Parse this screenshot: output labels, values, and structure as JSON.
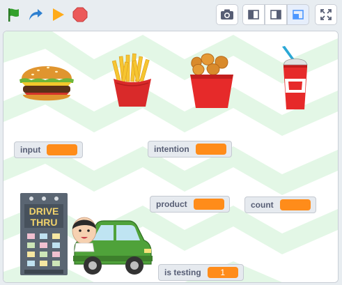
{
  "toolbar": {
    "icons": [
      "green-flag-icon",
      "turbo-arrow-icon",
      "play-icon",
      "stop-icon",
      "camera-icon",
      "small-stage-icon",
      "large-stage-icon",
      "custom-stage-icon",
      "fullscreen-icon"
    ],
    "colors": {
      "flag": "#33a02c",
      "turbo": "#2f80d0",
      "play": "#ffab19",
      "stop": "#ec5959",
      "active_view": "#4c97ff"
    }
  },
  "stage": {
    "background_colors": {
      "stripe": "#e3f7e6",
      "base": "#ffffff"
    },
    "sprites": [
      "burger",
      "fries",
      "chicken-nuggets",
      "drink",
      "drive-thru-sign",
      "car-with-driver"
    ],
    "drive_thru_sign": {
      "line1": "DRIVE",
      "line2": "THRU"
    }
  },
  "monitors": {
    "input": {
      "label": "input",
      "value": ""
    },
    "intention": {
      "label": "intention",
      "value": ""
    },
    "product": {
      "label": "product",
      "value": ""
    },
    "count": {
      "label": "count",
      "value": ""
    },
    "is_testing": {
      "label": "is testing",
      "value": "1"
    }
  },
  "colors": {
    "monitor_value": "#ff8c1a",
    "monitor_label": "#575e75"
  }
}
